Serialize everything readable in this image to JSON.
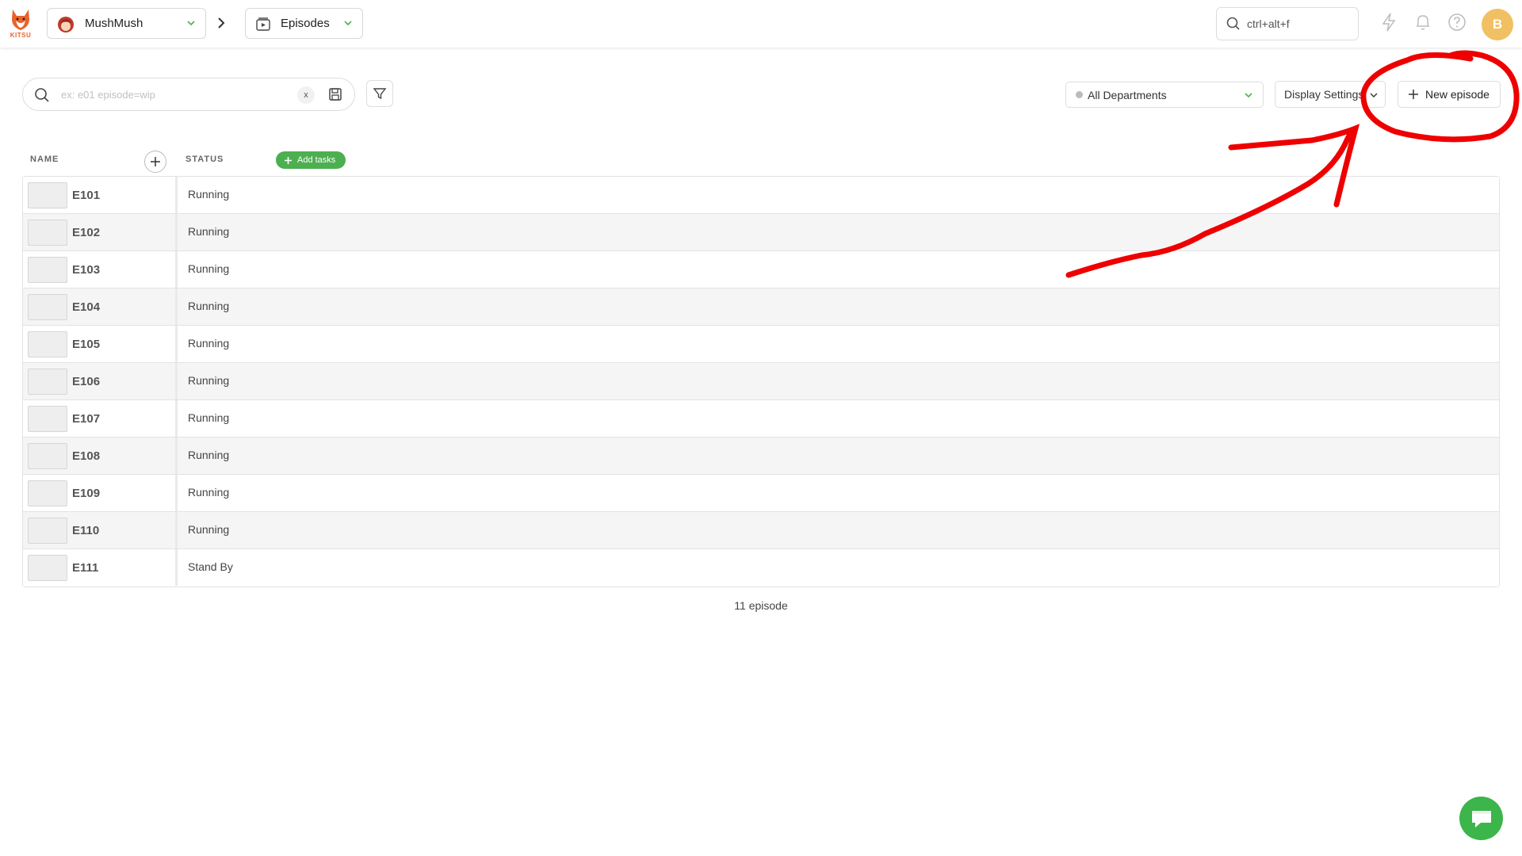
{
  "header": {
    "logo_text": "KITSU",
    "production": "MushMush",
    "section": "Episodes",
    "search_placeholder": "ctrl+alt+f",
    "avatar_initial": "B"
  },
  "filters": {
    "search_placeholder": "ex: e01 episode=wip",
    "clear_label": "x",
    "department": "All Departments",
    "display_settings": "Display Settings",
    "new_episode": "New episode"
  },
  "table": {
    "columns": {
      "name": "NAME",
      "status": "STATUS"
    },
    "add_tasks": "Add tasks",
    "rows": [
      {
        "name": "E101",
        "status": "Running"
      },
      {
        "name": "E102",
        "status": "Running"
      },
      {
        "name": "E103",
        "status": "Running"
      },
      {
        "name": "E104",
        "status": "Running"
      },
      {
        "name": "E105",
        "status": "Running"
      },
      {
        "name": "E106",
        "status": "Running"
      },
      {
        "name": "E107",
        "status": "Running"
      },
      {
        "name": "E108",
        "status": "Running"
      },
      {
        "name": "E109",
        "status": "Running"
      },
      {
        "name": "E110",
        "status": "Running"
      },
      {
        "name": "E111",
        "status": "Stand By"
      }
    ]
  },
  "footer": {
    "count": "11 episode"
  },
  "colors": {
    "accent_green": "#4caf50",
    "avatar": "#f0c062",
    "annotation_red": "#ee0000",
    "kitsu_orange": "#e9632b"
  },
  "icons": [
    "kitsu-logo-icon",
    "chevron-down-icon",
    "chevron-right-icon",
    "episodes-icon",
    "search-icon",
    "lightning-icon",
    "bell-icon",
    "help-icon",
    "save-icon",
    "filter-icon",
    "plus-icon",
    "chat-icon"
  ]
}
